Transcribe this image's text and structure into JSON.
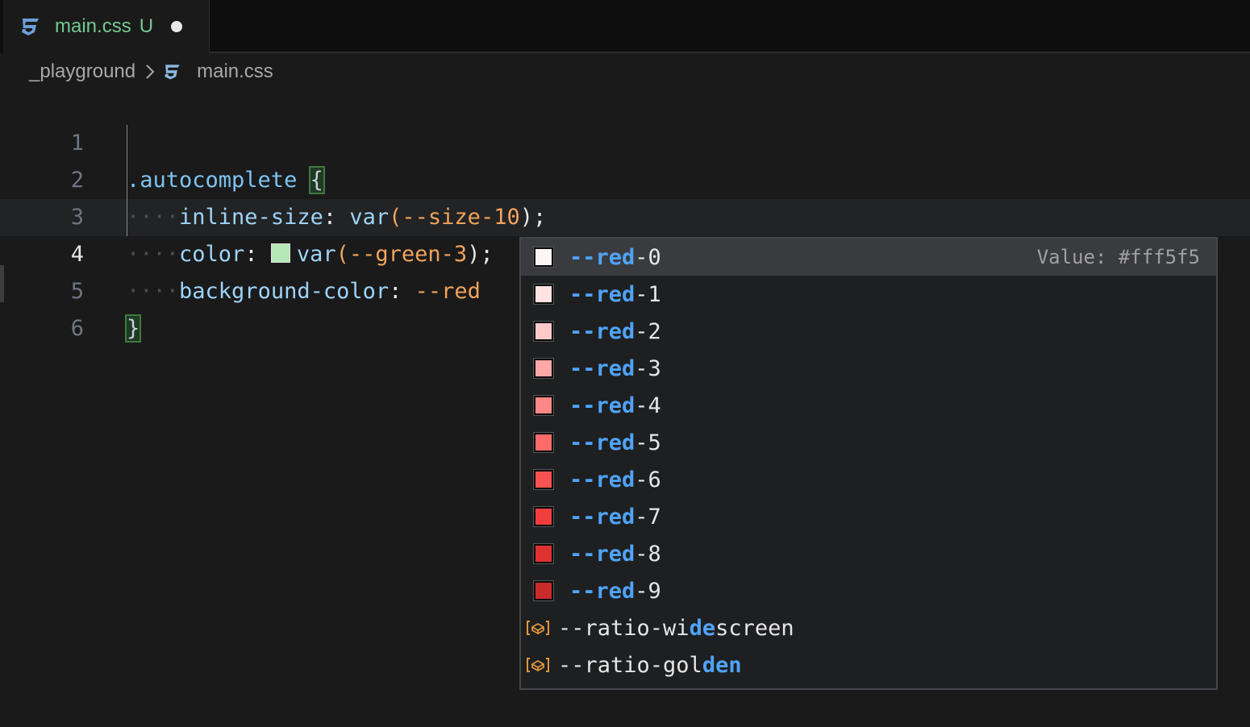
{
  "tab": {
    "filename": "main.css",
    "status": "U"
  },
  "breadcrumb": {
    "folder": "_playground",
    "file": "main.css"
  },
  "editor": {
    "lines": [
      {
        "n": "1",
        "selector": ".autocomplete",
        "brace": "{"
      },
      {
        "n": "2",
        "ws": "····",
        "prop": "inline-size",
        "colon": ": ",
        "fn": "var",
        "open": "(",
        "var": "--size-10",
        "close": ");"
      },
      {
        "n": "3",
        "ws": "····",
        "prop": "color",
        "colon": ": ",
        "swatch": "#b5e6b5",
        "fn": "var",
        "open": "(",
        "var": "--green-3",
        "close": ");"
      },
      {
        "n": "4",
        "ws": "····",
        "prop": "background-color",
        "colon": ": ",
        "typed": "--red"
      },
      {
        "n": "5",
        "brace": "}"
      },
      {
        "n": "6"
      }
    ],
    "active_line": "4"
  },
  "suggestions": {
    "selected_detail": "Value: #fff5f5",
    "items": [
      {
        "pre": "--",
        "hl": "red",
        "post": "-0",
        "color": "#fff5f5"
      },
      {
        "pre": "--",
        "hl": "red",
        "post": "-1",
        "color": "#ffe3e3"
      },
      {
        "pre": "--",
        "hl": "red",
        "post": "-2",
        "color": "#ffc9c9"
      },
      {
        "pre": "--",
        "hl": "red",
        "post": "-3",
        "color": "#ffa8a8"
      },
      {
        "pre": "--",
        "hl": "red",
        "post": "-4",
        "color": "#ff8787"
      },
      {
        "pre": "--",
        "hl": "red",
        "post": "-5",
        "color": "#ff6b6b"
      },
      {
        "pre": "--",
        "hl": "red",
        "post": "-6",
        "color": "#fa5252"
      },
      {
        "pre": "--",
        "hl": "red",
        "post": "-7",
        "color": "#f03e3e"
      },
      {
        "pre": "--",
        "hl": "red",
        "post": "-8",
        "color": "#e03131"
      },
      {
        "pre": "--",
        "hl": "red",
        "post": "-9",
        "color": "#c92a2a"
      }
    ],
    "var_items": [
      {
        "pre": "--ratio-wi",
        "hl": "de",
        "post": "screen"
      },
      {
        "pre": "--ratio-gol",
        "hl": "den",
        "post": ""
      }
    ]
  },
  "icons": {
    "file_type": "css3-icon",
    "variable": "variable-icon",
    "separator": "chevron-right-icon"
  }
}
